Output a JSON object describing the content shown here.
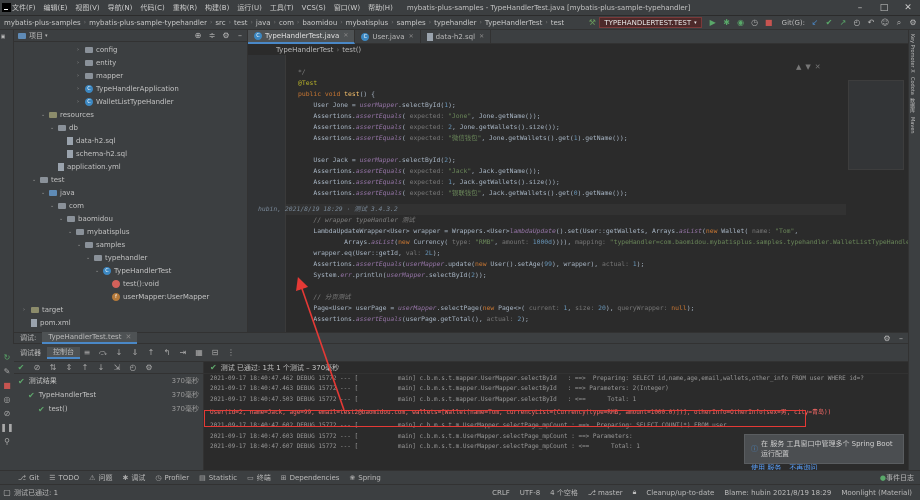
{
  "titlebar": {
    "menus": [
      "文件(F)",
      "编辑(E)",
      "视图(V)",
      "导航(N)",
      "代码(C)",
      "重构(R)",
      "构建(B)",
      "运行(U)",
      "工具(T)",
      "VCS(S)",
      "窗口(W)",
      "帮助(H)"
    ],
    "title": "mybatis-plus-samples - TypeHandlerTest.java [mybatis-plus-sample-typehandler]"
  },
  "navbar": {
    "crumbs": [
      "mybatis-plus-samples",
      "mybatis-plus-sample-typehandler",
      "src",
      "test",
      "java",
      "com",
      "baomidou",
      "mybatisplus",
      "samples",
      "typehandler",
      "TypeHandlerTest",
      "test"
    ],
    "run_config": "TYPEHANDLERTEST.TEST",
    "git_label": "Git(G):"
  },
  "project": {
    "label": "项目",
    "items": [
      {
        "indent": 7,
        "arrow": "›",
        "icon": "folder",
        "label": "config"
      },
      {
        "indent": 7,
        "arrow": "›",
        "icon": "folder",
        "label": "entity"
      },
      {
        "indent": 7,
        "arrow": "›",
        "icon": "folder",
        "label": "mapper"
      },
      {
        "indent": 7,
        "arrow": "›",
        "icon": "class",
        "label": "TypeHandlerApplication"
      },
      {
        "indent": 7,
        "arrow": "›",
        "icon": "class",
        "label": "WalletListTypeHandler"
      },
      {
        "indent": 3,
        "arrow": "⌄",
        "icon": "res",
        "label": "resources"
      },
      {
        "indent": 4,
        "arrow": "⌄",
        "icon": "folder",
        "label": "db"
      },
      {
        "indent": 5,
        "arrow": "",
        "icon": "file",
        "label": "data-h2.sql"
      },
      {
        "indent": 5,
        "arrow": "",
        "icon": "file",
        "label": "schema-h2.sql"
      },
      {
        "indent": 4,
        "arrow": "",
        "icon": "file",
        "label": "application.yml"
      },
      {
        "indent": 2,
        "arrow": "⌄",
        "icon": "folder",
        "label": "test"
      },
      {
        "indent": 3,
        "arrow": "⌄",
        "icon": "blue",
        "label": "java"
      },
      {
        "indent": 4,
        "arrow": "⌄",
        "icon": "folder",
        "label": "com"
      },
      {
        "indent": 5,
        "arrow": "⌄",
        "icon": "folder",
        "label": "baomidou"
      },
      {
        "indent": 6,
        "arrow": "⌄",
        "icon": "folder",
        "label": "mybatisplus"
      },
      {
        "indent": 7,
        "arrow": "⌄",
        "icon": "folder",
        "label": "samples"
      },
      {
        "indent": 8,
        "arrow": "⌄",
        "icon": "folder",
        "label": "typehandler"
      },
      {
        "indent": 9,
        "arrow": "⌄",
        "icon": "class",
        "label": "TypeHandlerTest"
      },
      {
        "indent": 10,
        "arrow": "",
        "icon": "method",
        "label": "test():void"
      },
      {
        "indent": 10,
        "arrow": "",
        "icon": "field",
        "label": "userMapper:UserMapper"
      },
      {
        "indent": 1,
        "arrow": "›",
        "icon": "res",
        "label": "target"
      },
      {
        "indent": 1,
        "arrow": "",
        "icon": "file",
        "label": "pom.xml"
      }
    ]
  },
  "editor": {
    "tabs": [
      {
        "label": "TypeHandlerTest.java",
        "active": true
      },
      {
        "label": "User.java",
        "active": false
      },
      {
        "label": "data-h2.sql",
        "active": false
      }
    ],
    "breadcrumb": [
      "TypeHandlerTest",
      "test()"
    ],
    "blame": "hubin, 2021/8/19 18:29 · 测试 3.4.3.2",
    "wrapper_comment": "// wrapper typeHandler 测试",
    "paging_comment": "// 分页测试"
  },
  "debug": {
    "tabs": [
      {
        "label": "调试:",
        "active": false
      },
      {
        "label": "TypeHandlerTest.test",
        "active": true
      }
    ],
    "subtabs": [
      "调试器",
      "控制台"
    ],
    "status": "测试 已通过: 1共 1 个测试 – 370毫秒",
    "tree": [
      {
        "label": "测试结果",
        "duration": "370毫秒",
        "indent": 0
      },
      {
        "label": "TypeHandlerTest",
        "duration": "370毫秒",
        "indent": 1
      },
      {
        "label": "test()",
        "duration": "370毫秒",
        "indent": 2
      }
    ],
    "log": [
      {
        "kind": "dim",
        "text": "2021-09-17 18:40:47.462 DEBUG 15772 --- [           main] c.b.m.s.t.mapper.UserMapper.selectById   : ==>  Preparing: SELECT id,name,age,email,wallets,other_info FROM user WHERE id=?"
      },
      {
        "kind": "dim",
        "text": "2021-09-17 18:40:47.463 DEBUG 15772 --- [           main] c.b.m.s.t.mapper.UserMapper.selectById   : ==> Parameters: 2(Integer)"
      },
      {
        "kind": "dim",
        "text": "2021-09-17 18:40:47.503 DEBUG 15772 --- [           main] c.b.m.s.t.mapper.UserMapper.selectById   : <==      Total: 1"
      },
      {
        "kind": "err",
        "text": "User(id=2, name=Jack, age=99, email=test2@baomidou.com, wallets=[Wallet(name=Tom, currencyList=[Currency(type=RMB, amount=1000.0)])], otherInfo=OtherInfo(sex=男, city=青岛))"
      },
      {
        "kind": "dim",
        "text": "2021-09-17 18:40:47.602 DEBUG 15772 --- [           main] c.b.m.s.t.m.UserMapper.selectPage_mpCount : ==>  Preparing: SELECT COUNT(*) FROM user"
      },
      {
        "kind": "dim",
        "text": "2021-09-17 18:40:47.603 DEBUG 15772 --- [           main] c.b.m.s.t.m.UserMapper.selectPage_mpCount : ==> Parameters: "
      },
      {
        "kind": "dim",
        "text": "2021-09-17 18:40:47.607 DEBUG 15772 --- [           main] c.b.m.s.t.m.UserMapper.selectPage_mpCount : <==      Total: 1"
      }
    ]
  },
  "notification": {
    "text": "在 服务 工具窗口中管理多个 Spring Boot 运行配置",
    "actions": [
      "使用 服务",
      "不再询问"
    ]
  },
  "bottom_tools": [
    "Git",
    "TODO",
    "问题",
    "调试",
    "Profiler",
    "Statistic",
    "终端",
    "Dependencies",
    "Spring"
  ],
  "statusbar": {
    "left": "测试已通过: 1",
    "crlf": "CRLF",
    "encoding": "UTF-8",
    "indent": "4 个空格",
    "branch": "master",
    "cleanup": "Cleanup/up-to-date",
    "blame": "Blame: hubin 2021/8/19 18:29",
    "theme": "Moonlight (Material)",
    "event_log": "事件日志"
  },
  "colors": {
    "accent": "#4a88c7",
    "annotation_red": "#e53935",
    "pass_green": "#5fa86c"
  }
}
